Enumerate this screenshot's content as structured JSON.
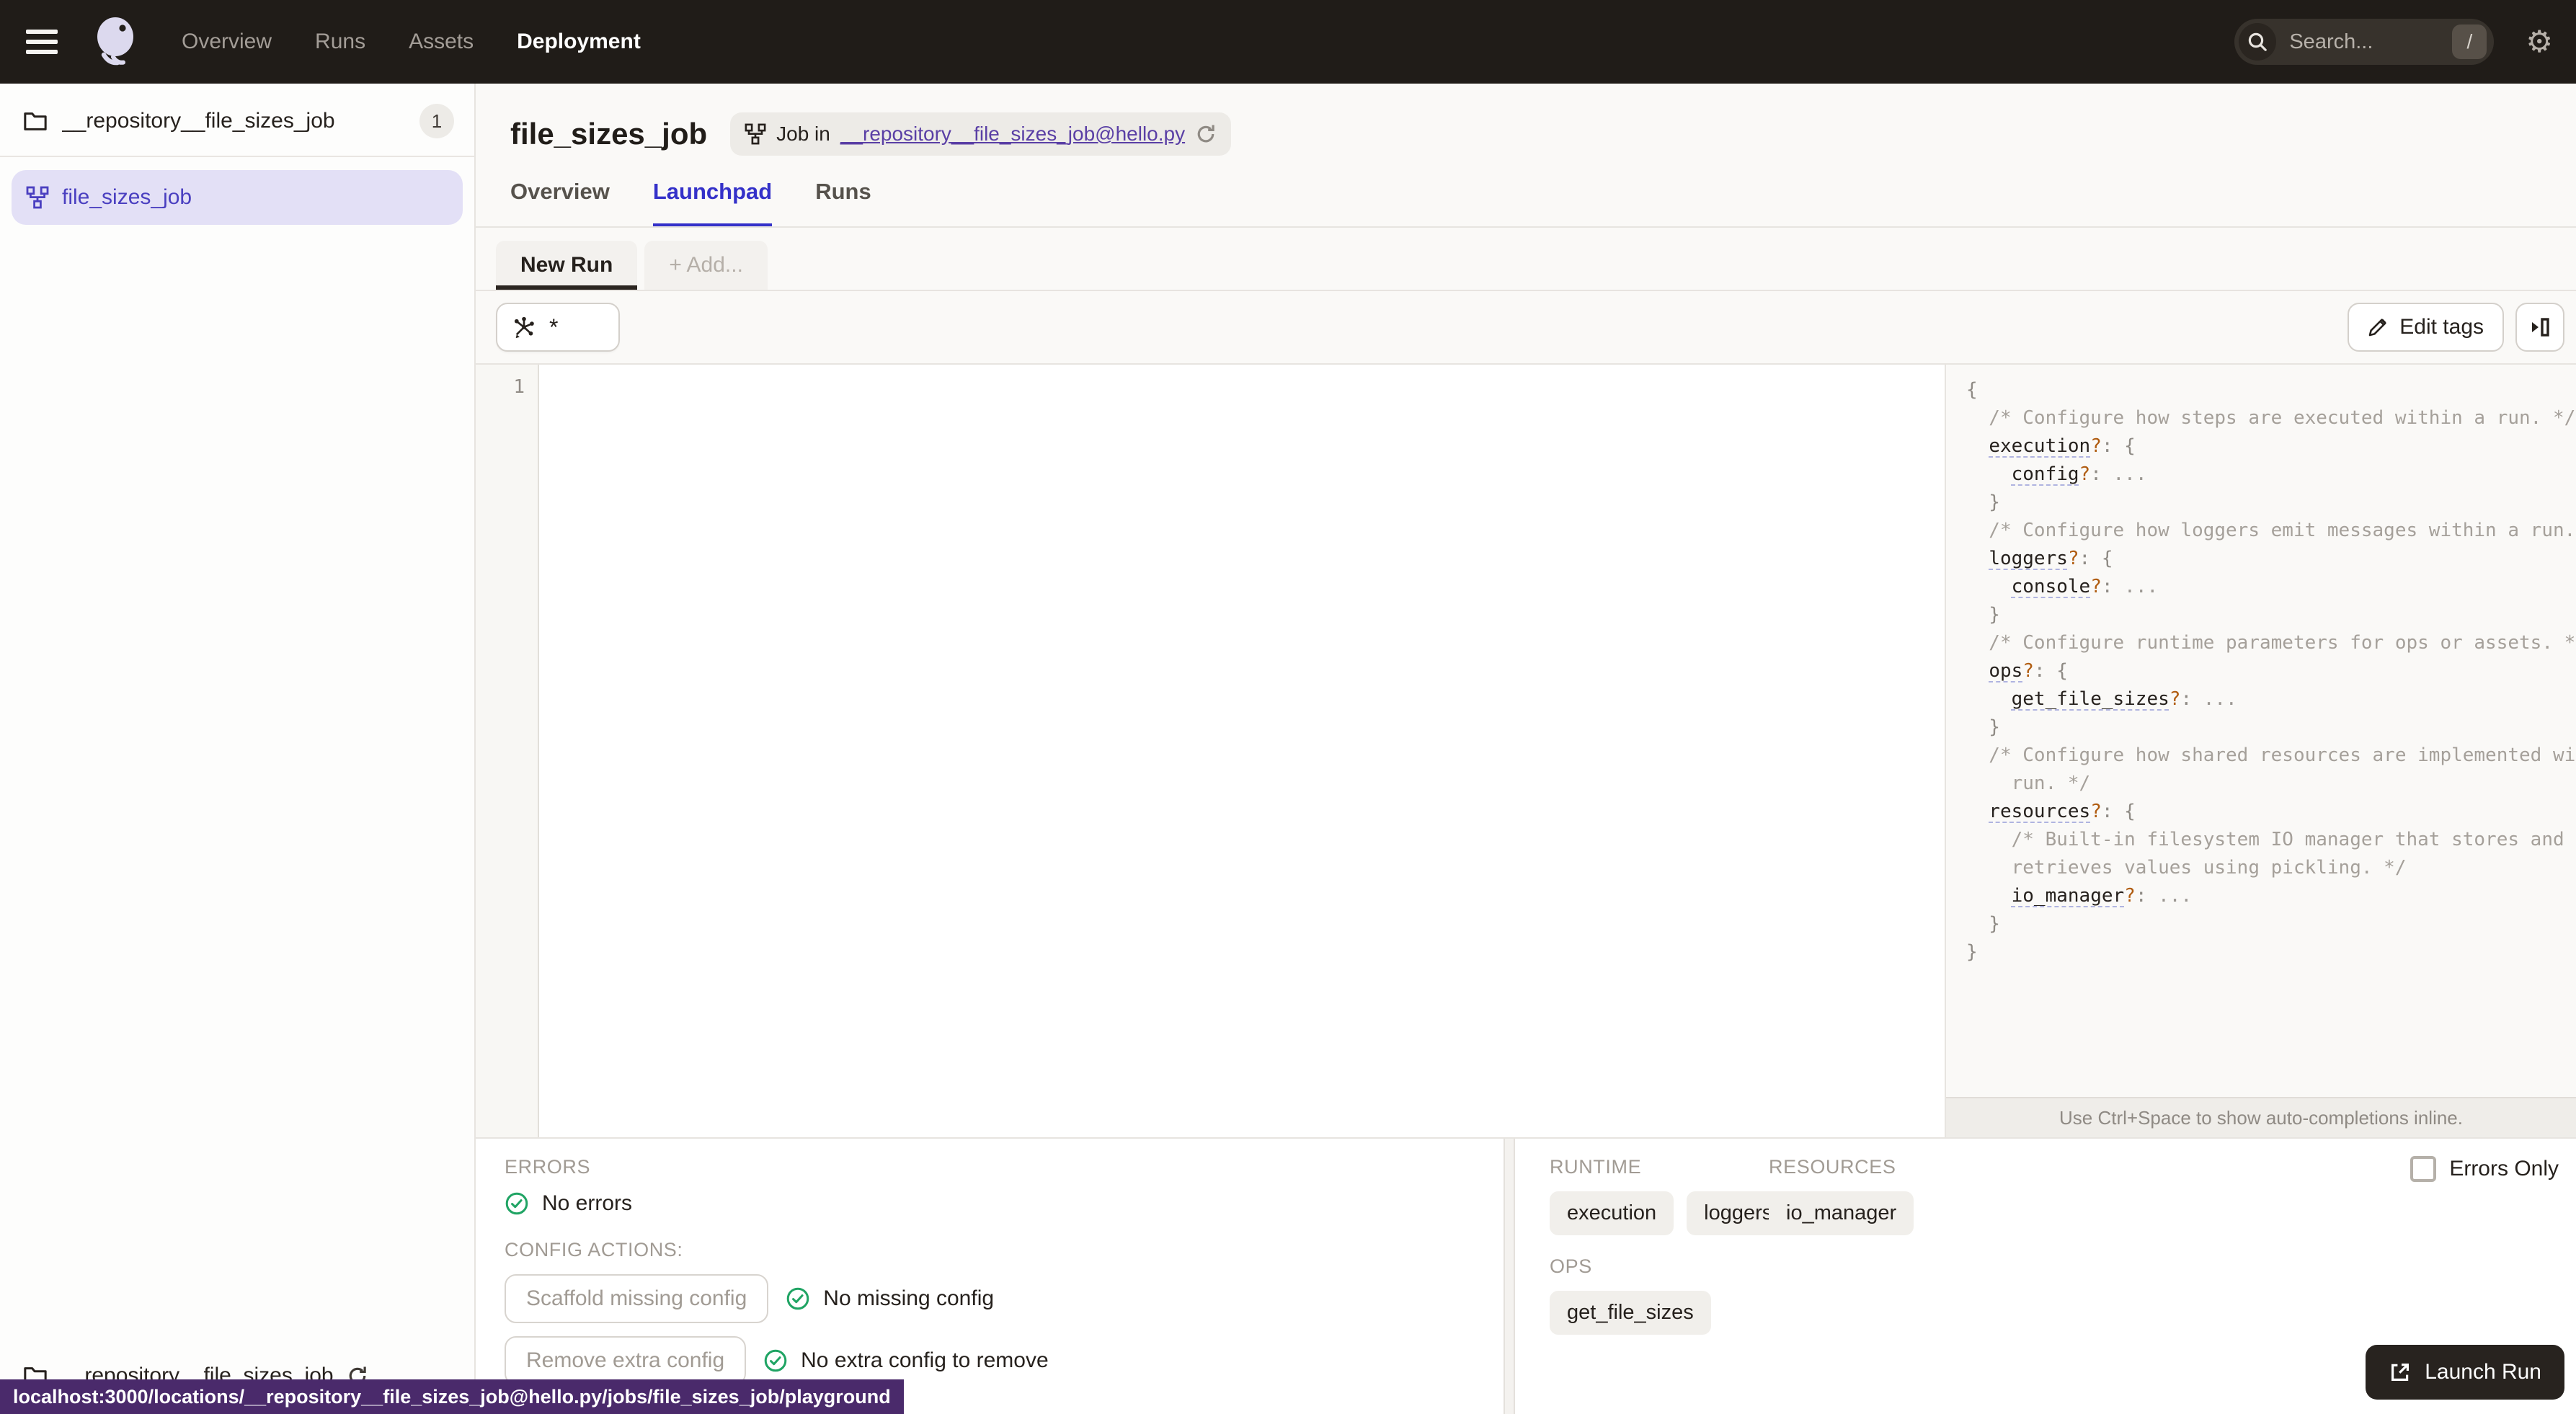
{
  "nav": {
    "items": [
      {
        "label": "Overview"
      },
      {
        "label": "Runs"
      },
      {
        "label": "Assets"
      },
      {
        "label": "Deployment",
        "active": true
      }
    ],
    "search": {
      "placeholder": "Search...",
      "shortcut": "/"
    }
  },
  "sidebar": {
    "group": {
      "label": "__repository__file_sizes_job",
      "count": "1"
    },
    "selected_item": {
      "label": "file_sizes_job"
    },
    "footer": {
      "label": "__repository__file_sizes_job"
    }
  },
  "status_tooltip": {
    "url": "localhost:3000/locations/__repository__file_sizes_job@hello.py/jobs/file_sizes_job/playground"
  },
  "header": {
    "title": "file_sizes_job",
    "job_pill": {
      "prefix": "Job in",
      "link": "__repository__file_sizes_job@hello.py"
    }
  },
  "tabs": {
    "overview": "Overview",
    "launchpad": "Launchpad",
    "runs": "Runs"
  },
  "launchpad": {
    "session_tabs": {
      "new_run": "New Run",
      "add": "+ Add..."
    },
    "op_selector_value": "*",
    "edit_tags_label": "Edit tags"
  },
  "editor": {
    "line_number": "1"
  },
  "config_panel": {
    "hint": "Use Ctrl+Space to show auto-completions inline.",
    "lines": [
      [
        [
          "p",
          "{"
        ]
      ],
      [
        [
          "c",
          "  /* Configure how steps are executed within a run. */"
        ]
      ],
      [
        [
          "p",
          "  "
        ],
        [
          "k",
          "execution"
        ],
        [
          "q",
          "?"
        ],
        [
          "p",
          ": {"
        ]
      ],
      [
        [
          "p",
          "    "
        ],
        [
          "k",
          "config"
        ],
        [
          "q",
          "?"
        ],
        [
          "p",
          ": "
        ],
        [
          "e",
          "..."
        ]
      ],
      [
        [
          "p",
          "  }"
        ]
      ],
      [
        [
          "c",
          "  /* Configure how loggers emit messages within a run. */"
        ]
      ],
      [
        [
          "p",
          "  "
        ],
        [
          "k",
          "loggers"
        ],
        [
          "q",
          "?"
        ],
        [
          "p",
          ": {"
        ]
      ],
      [
        [
          "p",
          "    "
        ],
        [
          "k",
          "console"
        ],
        [
          "q",
          "?"
        ],
        [
          "p",
          ": "
        ],
        [
          "e",
          "..."
        ]
      ],
      [
        [
          "p",
          "  }"
        ]
      ],
      [
        [
          "c",
          "  /* Configure runtime parameters for ops or assets. */"
        ]
      ],
      [
        [
          "p",
          "  "
        ],
        [
          "k",
          "ops"
        ],
        [
          "q",
          "?"
        ],
        [
          "p",
          ": {"
        ]
      ],
      [
        [
          "p",
          "    "
        ],
        [
          "k",
          "get_file_sizes"
        ],
        [
          "q",
          "?"
        ],
        [
          "p",
          ": "
        ],
        [
          "e",
          "..."
        ]
      ],
      [
        [
          "p",
          "  }"
        ]
      ],
      [
        [
          "c",
          "  /* Configure how shared resources are implemented within a"
        ]
      ],
      [
        [
          "c",
          "    run. */"
        ]
      ],
      [
        [
          "p",
          "  "
        ],
        [
          "k",
          "resources"
        ],
        [
          "q",
          "?"
        ],
        [
          "p",
          ": {"
        ]
      ],
      [
        [
          "c",
          "    /* Built-in filesystem IO manager that stores and"
        ]
      ],
      [
        [
          "c",
          "    retrieves values using pickling. */"
        ]
      ],
      [
        [
          "p",
          "    "
        ],
        [
          "k",
          "io_manager"
        ],
        [
          "q",
          "?"
        ],
        [
          "p",
          ": "
        ],
        [
          "e",
          "..."
        ]
      ],
      [
        [
          "p",
          "  }"
        ]
      ],
      [
        [
          "p",
          "}"
        ]
      ]
    ]
  },
  "bottom_panel": {
    "errors_heading": "ERRORS",
    "errors_status": "No errors",
    "config_actions_heading": "CONFIG ACTIONS:",
    "actions": [
      {
        "button": "Scaffold missing config",
        "status": "No missing config"
      },
      {
        "button": "Remove extra config",
        "status": "No extra config to remove"
      }
    ],
    "errors_only_label": "Errors Only",
    "runtime_heading": "RUNTIME",
    "runtime_tags": [
      "execution",
      "loggers"
    ],
    "resources_heading": "RESOURCES",
    "resources_tags": [
      "io_manager"
    ],
    "ops_heading": "OPS",
    "ops_tags": [
      "get_file_sizes"
    ],
    "launch_button": "Launch Run"
  },
  "colors": {
    "nav_bg": "#201c18",
    "accent_blue": "#3431c9",
    "selected_item_bg": "#e3e0f6",
    "selected_item_text": "#4a3fc0",
    "link_purple": "#5a3fa5",
    "status_green": "#20a464",
    "tooltip_bg": "#4a2a6b",
    "launch_button_bg": "#28231f",
    "question_mark_orange": "#b05c10"
  }
}
